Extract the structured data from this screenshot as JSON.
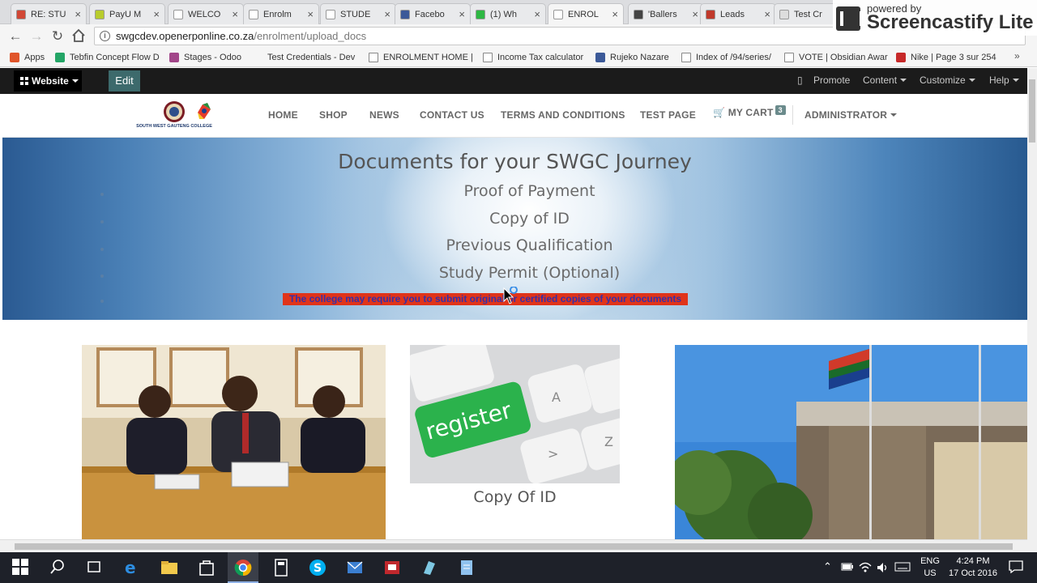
{
  "browser": {
    "tabs": [
      {
        "title": "RE: STU",
        "favicon_color": "#d14836"
      },
      {
        "title": "PayU M",
        "favicon_color": "#b8cc2d"
      },
      {
        "title": "WELCO",
        "favicon_color": "#ffffff"
      },
      {
        "title": "Enrolm",
        "favicon_color": "#ffffff"
      },
      {
        "title": "STUDE",
        "favicon_color": "#ffffff"
      },
      {
        "title": "Facebo",
        "favicon_color": "#3b5998"
      },
      {
        "title": "(1) Wh",
        "favicon_color": "#2eb843"
      },
      {
        "title": "ENROL",
        "favicon_color": "#ffffff"
      },
      {
        "title": "'Ballers",
        "favicon_color": "#444444"
      },
      {
        "title": "Leads",
        "favicon_color": "#c0392b"
      },
      {
        "title": "Test Cr",
        "favicon_color": "#dddddd"
      }
    ],
    "url_host": "swgcdev.openerponline.co.za",
    "url_path": "/enrolment/upload_docs",
    "bookmarks": [
      {
        "label": "Apps",
        "icon": "apps-grid-icon",
        "color": "#e0552a"
      },
      {
        "label": "Tebfin Concept Flow D",
        "icon": "sheets-icon",
        "color": "#23a566"
      },
      {
        "label": "Stages - Odoo",
        "icon": "odoo-icon",
        "color": "#a24689"
      },
      {
        "label": "Test Credentials - Dev",
        "icon": "drive-icon",
        "color": "#f5f5f5"
      },
      {
        "label": "ENROLMENT HOME |",
        "icon": "page-icon",
        "color": "#ffffff"
      },
      {
        "label": "Income Tax calculator",
        "icon": "page-icon",
        "color": "#ffffff"
      },
      {
        "label": "Rujeko Nazare",
        "icon": "facebook-icon",
        "color": "#3b5998"
      },
      {
        "label": "Index of /94/series/",
        "icon": "page-icon",
        "color": "#ffffff"
      },
      {
        "label": "VOTE | Obsidian Awar",
        "icon": "page-icon",
        "color": "#ffffff"
      },
      {
        "label": "Nike | Page 3 sur 254",
        "icon": "spi-icon",
        "color": "#c62828"
      }
    ],
    "screencastify": {
      "powered": "powered by",
      "brand": "Screencastify Lite"
    }
  },
  "admin_bar": {
    "website_label": "Website",
    "edit_label": "Edit",
    "promote": "Promote",
    "content": "Content",
    "customize": "Customize",
    "help": "Help"
  },
  "site_nav": {
    "logo_text": "SOUTH WEST GAUTENG COLLEGE",
    "items": [
      "HOME",
      "SHOP",
      "NEWS",
      "CONTACT US",
      "TERMS AND CONDITIONS",
      "TEST PAGE"
    ],
    "cart_label": "MY CART",
    "cart_count": "3",
    "admin_label": "ADMINISTRATOR"
  },
  "hero": {
    "title": "Documents for your SWGC Journey",
    "items": [
      "Proof of Payment",
      "Copy of ID",
      "Previous Qualification",
      "Study Permit (Optional)"
    ],
    "notice": "The college may require you to submit original or certified copies of your documents"
  },
  "cards": [
    {
      "caption": ""
    },
    {
      "caption": "Copy Of ID",
      "key_label": "register"
    },
    {
      "caption": ""
    }
  ],
  "taskbar": {
    "lang": "ENG",
    "region": "US",
    "time": "4:24 PM",
    "date": "17 Oct 2016"
  }
}
